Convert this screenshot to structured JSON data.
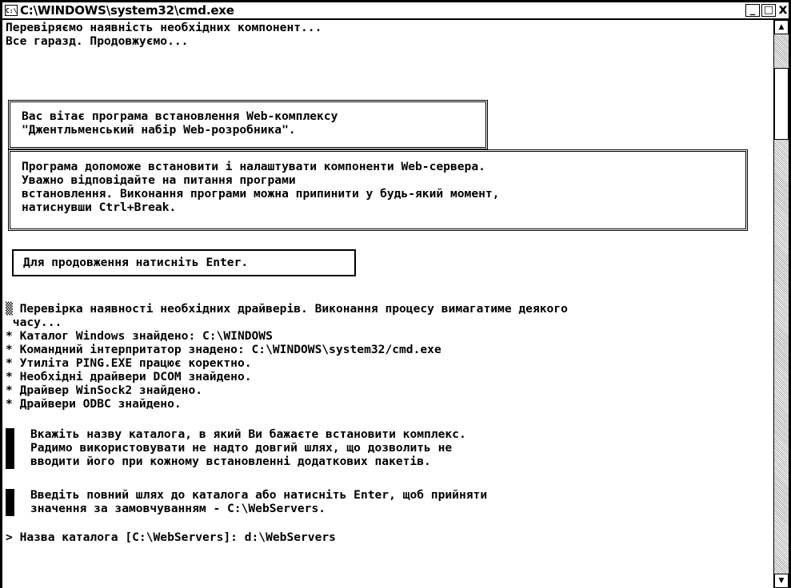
{
  "window": {
    "title": "C:\\WINDOWS\\system32\\cmd.exe",
    "icon_label": "C:\\",
    "minimize_label": "_",
    "maximize_label": "□",
    "close_label": "x"
  },
  "console": {
    "check1": "Перевіряємо наявність необхідних компонент...",
    "check2": "Все гаразд. Продовжуємо...",
    "welcome": [
      "Вас вітає програма встановлення Web-комплексу",
      "\"Джентльменський набір Web-розробника\"."
    ],
    "intro": [
      "Програма допоможе встановити і налаштувати компоненти Web-сервера.",
      "Уважно відповідайте на питання програми",
      "встановлення. Виконання програми можна припинити у будь-який момент,",
      "натиснувши Ctrl+Break."
    ],
    "continue_prompt": "Для продовження натисніть Enter.",
    "drivers_check": [
      "▒ Перевірка наявності необхідних драйверів. Виконання процесу вимагатиме деякого",
      " часу..."
    ],
    "results": [
      "* Каталог Windows знайдено: C:\\WINDOWS",
      "* Командний інтерпритатор знадено: C:\\WINDOWS\\system32/cmd.exe",
      "* Утиліта PING.EXE працює коректно.",
      "* Необхідні драйвери DCOM знайдено.",
      "* Драйвер WinSock2 знайдено.",
      "* Драйвери ODBC знайдено."
    ],
    "dir_info": [
      "Вкажіть назву каталога, в який Ви бажаєте встановити комплекс.",
      "Радимо використовувати не надто довгий шлях, що дозволить не",
      "вводити його при кожному встановленні додаткових пакетів."
    ],
    "dir_enter": [
      "Введіть повний шлях до каталога або натисніть Enter, щоб прийняти",
      "значення за замовчуванням - C:\\WebServers."
    ],
    "input_line": "> Назва каталога [C:\\WebServers]: d:\\WebServers"
  },
  "scrollbar": {
    "up_arrow": "▲",
    "down_arrow": "▼"
  }
}
